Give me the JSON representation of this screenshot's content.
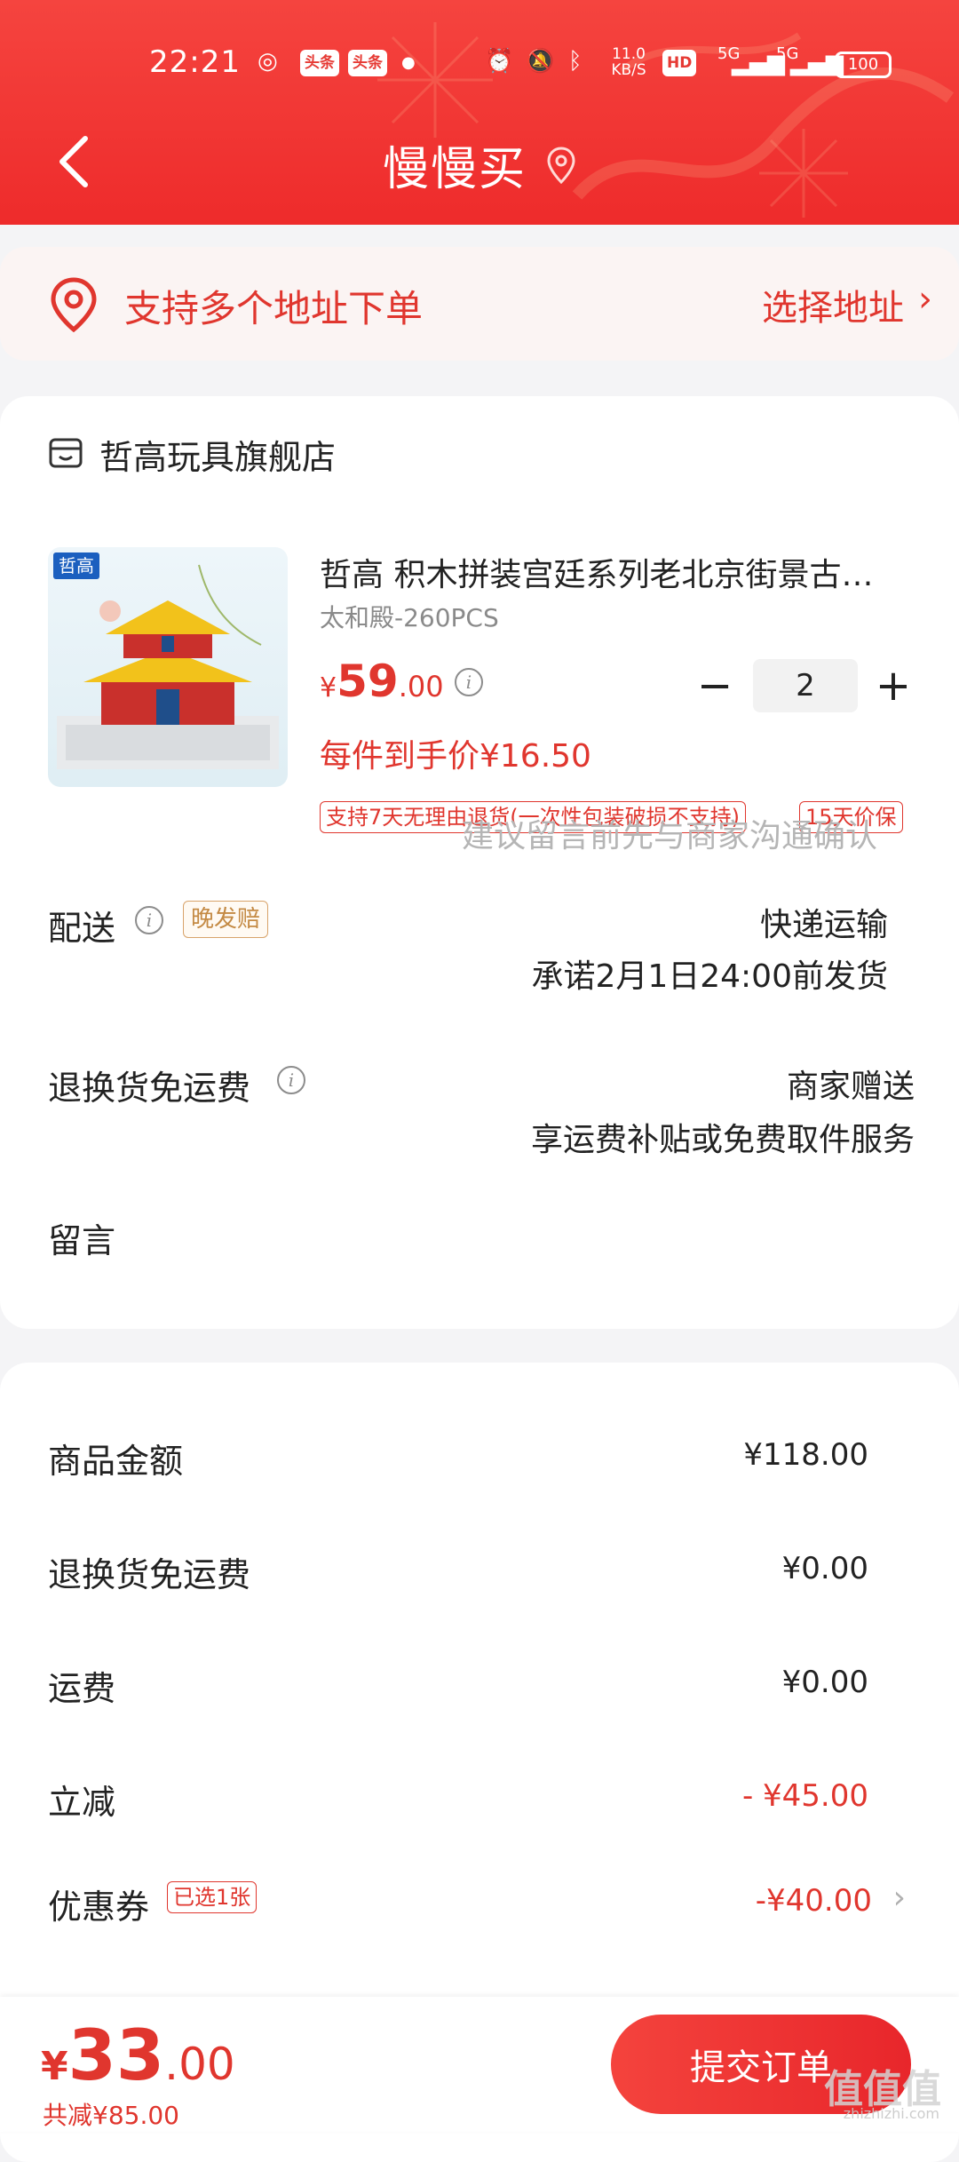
{
  "status_bar": {
    "time": "22:21",
    "net_speed": "11.0 KB/S",
    "hd_label": "HD",
    "signal1": "5G",
    "signal2": "5G",
    "battery": "100",
    "app_badge1": "头条",
    "app_badge2": "头条"
  },
  "header": {
    "title": "慢慢买",
    "bg_color": "#ee2b2b"
  },
  "address": {
    "label": "支持多个地址下单",
    "action": "选择地址",
    "chevron": "›"
  },
  "shop": {
    "name": "哲高玩具旗舰店"
  },
  "product": {
    "brand_logo": "哲高",
    "title": "哲高 积木拼装宫廷系列老北京街景古…",
    "sku": "太和殿-260PCS",
    "price_currency": "¥",
    "price_int": "59",
    "price_dec": ".00",
    "quantity": "2",
    "minus": "−",
    "plus": "+",
    "unit_price": "每件到手价¥16.50",
    "tags": [
      "支持7天无理由退货(一次性包装破损不支持)",
      "15天价保"
    ]
  },
  "delivery": {
    "label": "配送",
    "late_tag": "晚发赔",
    "method": "快递运输",
    "promise": "承诺2月1日24:00前发货"
  },
  "return_shipping": {
    "label": "退换货免运费",
    "value": "商家赠送",
    "desc": "享运费补贴或免费取件服务"
  },
  "message": {
    "label": "留言",
    "placeholder": "建议留言前先与商家沟通确认"
  },
  "summary": {
    "rows": [
      {
        "label": "商品金额",
        "value": "¥118.00"
      },
      {
        "label": "退换货免运费",
        "value": "¥0.00"
      },
      {
        "label": "运费",
        "value": "¥0.00"
      },
      {
        "label": "立减",
        "value": "- ¥45.00"
      },
      {
        "label": "优惠券",
        "value": "-¥40.00"
      }
    ],
    "coupon_tag": "已选1张",
    "chevron": "›"
  },
  "footer": {
    "currency": "¥",
    "total_int": "33",
    "total_dec": ".00",
    "saved": "共减¥85.00",
    "submit": "提交订单",
    "watermark": "值值值",
    "watermark_url": "zhizhizhi.com"
  },
  "colors": {
    "accent": "#e0362e",
    "header": "#ee2b2b",
    "late_tag": "#c48a44"
  },
  "icons": {
    "back": "back-arrow-icon",
    "pin": "location-pin-icon",
    "shop": "shop-icon",
    "info": "info-icon",
    "chevron": "chevron-right-icon"
  }
}
